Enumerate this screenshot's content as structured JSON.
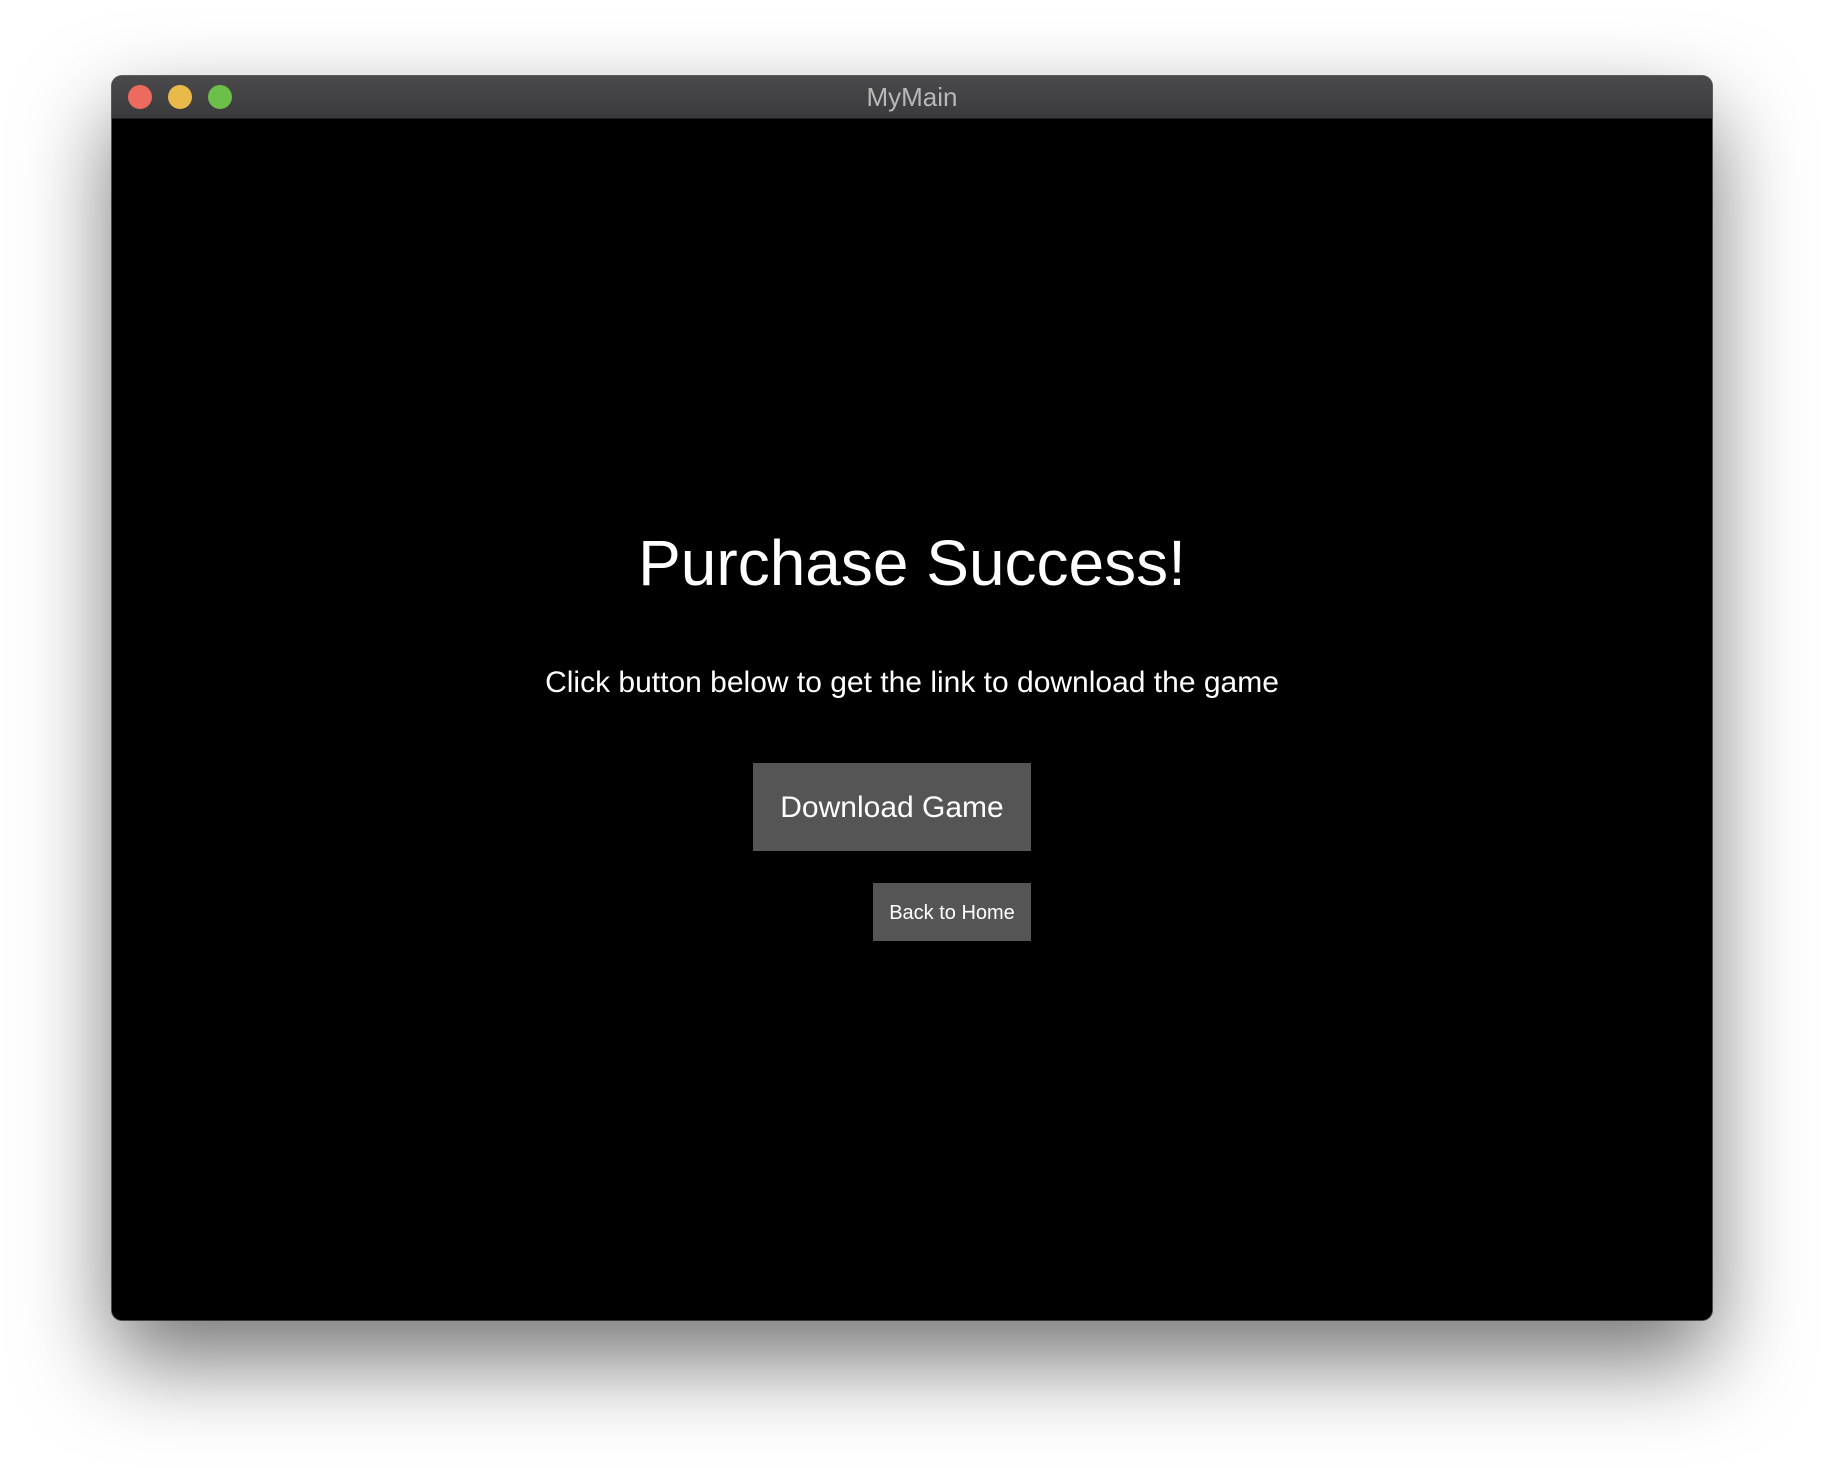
{
  "window": {
    "title": "MyMain"
  },
  "main": {
    "heading": "Purchase Success!",
    "subtext": "Click button below to get the link to download the game",
    "download_button_label": "Download Game",
    "home_button_label": "Back to Home"
  },
  "colors": {
    "background": "#000000",
    "button": "#555555",
    "text": "#ffffff",
    "close": "#ed6a5e",
    "minimize": "#e9b949",
    "maximize": "#6cc04a"
  }
}
